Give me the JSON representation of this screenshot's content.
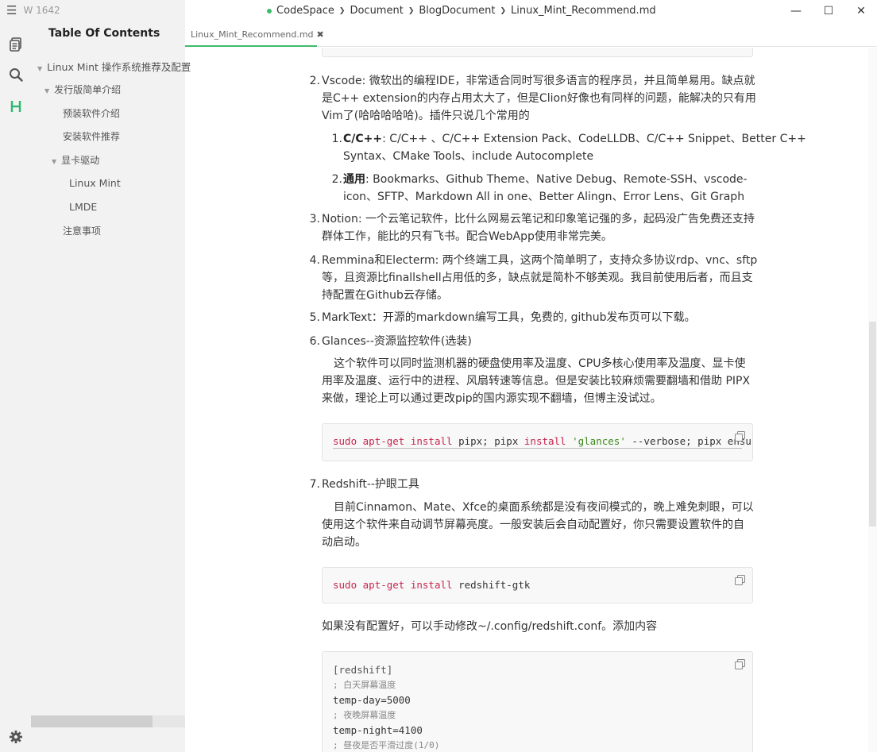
{
  "app": {
    "word_count": "W 1642"
  },
  "toc": {
    "title": "Table Of Contents",
    "items": [
      {
        "label": "Linux Mint 操作系统推荐及配置",
        "level": 0
      },
      {
        "label": "发行版简单介绍",
        "level": 1
      },
      {
        "label": "预装软件介绍",
        "level": 2
      },
      {
        "label": "安装软件推荐",
        "level": 2
      },
      {
        "label": "显卡驱动",
        "level": 1
      },
      {
        "label": "Linux Mint",
        "level": 3
      },
      {
        "label": "LMDE",
        "level": 3
      },
      {
        "label": "注意事项",
        "level": 2
      }
    ]
  },
  "breadcrumb": [
    "CodeSpace",
    "Document",
    "BlogDocument",
    "Linux_Mint_Recommend.md"
  ],
  "tab": {
    "label": "Linux_Mint_Recommend.md",
    "close": "✖"
  },
  "window": {
    "minimize": "—",
    "maximize": "☐",
    "close": "✕"
  },
  "content": {
    "item2": {
      "num": "2.",
      "lines": [
        "Vscode: 微软出的编程IDE，非常适合同时写很多语言的程序员，并且简单易用。缺点就",
        "是C++ extension的内存占用太大了，但是Clion好像也有同样的问题，能解决的只有用",
        "Vim了(哈哈哈哈哈)。插件只说几个常用的"
      ],
      "sub1": {
        "num": "1.",
        "label": "C/C++",
        "line1": ": C/C++ 、C/C++ Extension Pack、CodeLLDB、C/C++ Snippet、Better C++",
        "line2": "Syntax、CMake Tools、include Autocomplete"
      },
      "sub2": {
        "num": "2.",
        "label": "通用",
        "line1": ": Bookmarks、Github Theme、Native Debug、Remote-SSH、vscode-",
        "line2": "icon、SFTP、Markdown All in one、Better Alingn、Error Lens、Git Graph"
      }
    },
    "item3": {
      "num": "3.",
      "lines": [
        "Notion: 一个云笔记软件，比什么网易云笔记和印象笔记强的多，起码没广告免费还支持",
        "群体工作，能比的只有飞书。配合WebApp使用非常完美。"
      ]
    },
    "item4": {
      "num": "4.",
      "lines": [
        "Remmina和Electerm: 两个终端工具，这两个简单明了，支持众多协议rdp、vnc、sftp",
        "等，且资源比finallshell占用低的多，缺点就是简朴不够美观。我目前使用后者，而且支",
        "持配置在Github云存储。"
      ]
    },
    "item5": {
      "num": "5.",
      "text": "MarkText：开源的markdown编写工具，免费的, github发布页可以下载。"
    },
    "item6": {
      "num": "6.",
      "text": "Glances--资源监控软件(选装)",
      "para": [
        "这个软件可以同时监测机器的硬盘使用率及温度、CPU多核心使用率及温度、显卡使",
        "用率及温度、运行中的进程、风扇转速等信息。但是安装比较麻烦需要翻墙和借助 PIPX",
        "来做，理论上可以通过更改pip的国内源实现不翻墙，但博主没试过。"
      ],
      "code": {
        "t1": "sudo",
        "t2": "apt-get",
        "t3": "install",
        "t4": "pipx;",
        "t5": "pipx",
        "t6": "install",
        "t7": "'glances'",
        "t8": "--verbose;",
        "t9": "pipx ensu"
      }
    },
    "item7": {
      "num": "7.",
      "text": "Redshift--护眼工具",
      "para": [
        "目前Cinnamon、Mate、Xfce的桌面系统都是没有夜间模式的，晚上难免刺眼，可以",
        "使用这个软件来自动调节屏幕亮度。一般安装后会自动配置好，你只需要设置软件的自",
        "动启动。"
      ],
      "code": {
        "t1": "sudo",
        "t2": "apt-get",
        "t3": "install",
        "t4": "redshift-gtk"
      },
      "after": "如果没有配置好，可以手动修改~/.config/redshift.conf。添加内容",
      "conf": [
        "[redshift]",
        "; 白天屏幕温度",
        "temp-day=5000",
        "; 夜晚屏幕温度",
        "temp-night=4100",
        "; 昼夜是否平滑过度(1/0)"
      ]
    }
  }
}
